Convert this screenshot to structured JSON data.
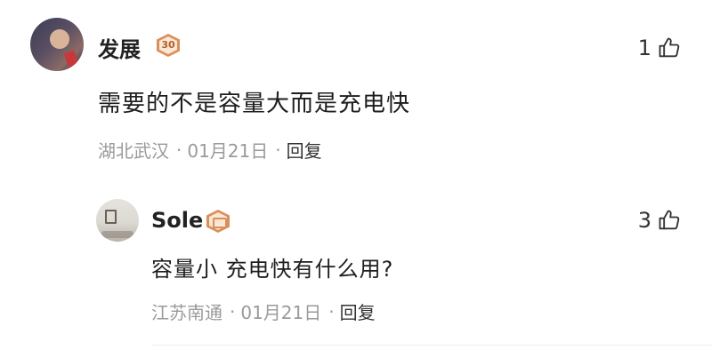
{
  "comments": [
    {
      "author": "发展",
      "level": "30",
      "text": "需要的不是容量大而是充电快",
      "location": "湖北武汉",
      "date": "01月21日",
      "reply_label": "回复",
      "likes": "1",
      "avatar": "user-avatar-photo"
    },
    {
      "author": "Sole",
      "level_icon": "cup-badge-icon",
      "text": "容量小 充电快有什么用?",
      "location": "江苏南通",
      "date": "01月21日",
      "reply_label": "回复",
      "likes": "3",
      "avatar": "user-avatar-photo"
    }
  ],
  "separator": "·",
  "colors": {
    "text_primary": "#1e1e1e",
    "text_meta": "#9a9a9a",
    "badge_orange": "#d98f5c"
  }
}
